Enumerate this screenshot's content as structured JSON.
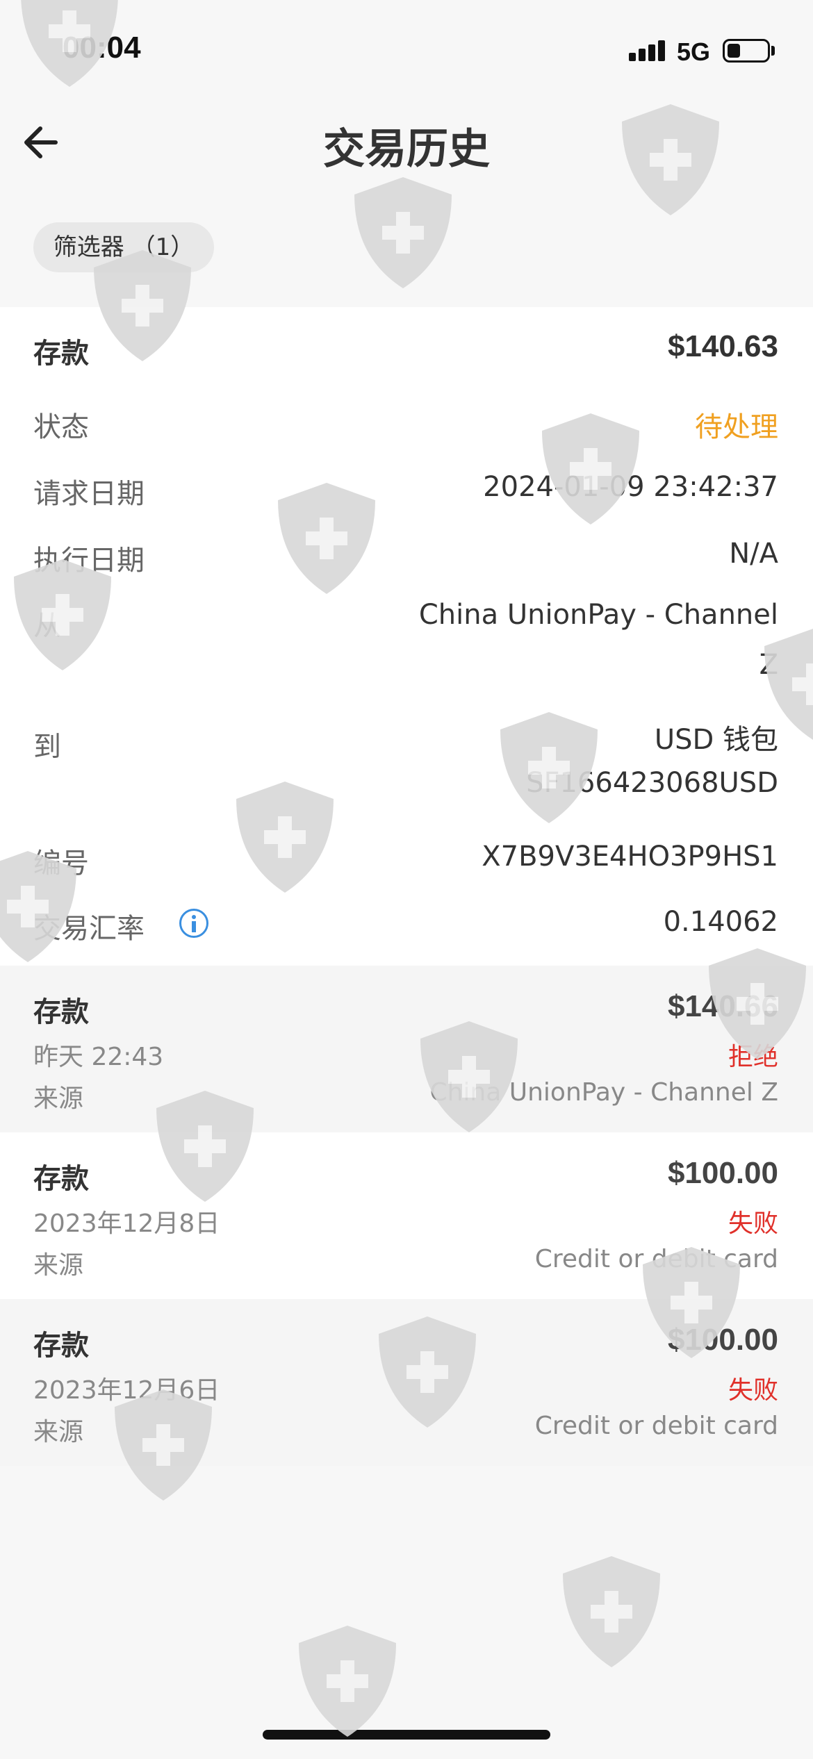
{
  "status_bar": {
    "time": "00:04",
    "network": "5G"
  },
  "header": {
    "title": "交易历史"
  },
  "filter": {
    "label": "筛选器 （1）"
  },
  "expanded": {
    "type": "存款",
    "amount": "$140.63",
    "status_label": "状态",
    "status_value": "待处理",
    "request_date_label": "请求日期",
    "request_date_value": "2024-01-09 23:42:37",
    "exec_date_label": "执行日期",
    "exec_date_value": "N/A",
    "from_label": "从",
    "from_value_line1": "China UnionPay - Channel",
    "from_value_line2": "Z",
    "to_label": "到",
    "to_value_line1": "USD 钱包",
    "to_value_line2": "SF166423068USD",
    "id_label": "编号",
    "id_value": "X7B9V3E4HO3P9HS1",
    "rate_label": "交易汇率",
    "rate_value": "0.14062"
  },
  "transactions": [
    {
      "type": "存款",
      "amount": "$140.66",
      "date": "昨天 22:43",
      "status": "拒绝",
      "source_label": "来源",
      "source_value": "China UnionPay - Channel Z"
    },
    {
      "type": "存款",
      "amount": "$100.00",
      "date": "2023年12月8日",
      "status": "失败",
      "source_label": "来源",
      "source_value": "Credit or debit card"
    },
    {
      "type": "存款",
      "amount": "$100.00",
      "date": "2023年12月6日",
      "status": "失败",
      "source_label": "来源",
      "source_value": "Credit or debit card"
    }
  ],
  "colors": {
    "pending": "#f0a020",
    "rejected": "#e0302a",
    "info": "#3a8fe0"
  },
  "icons": {
    "back": "arrow-left-icon",
    "info": "info-circle-icon",
    "watermark": "shield-cross-icon"
  }
}
